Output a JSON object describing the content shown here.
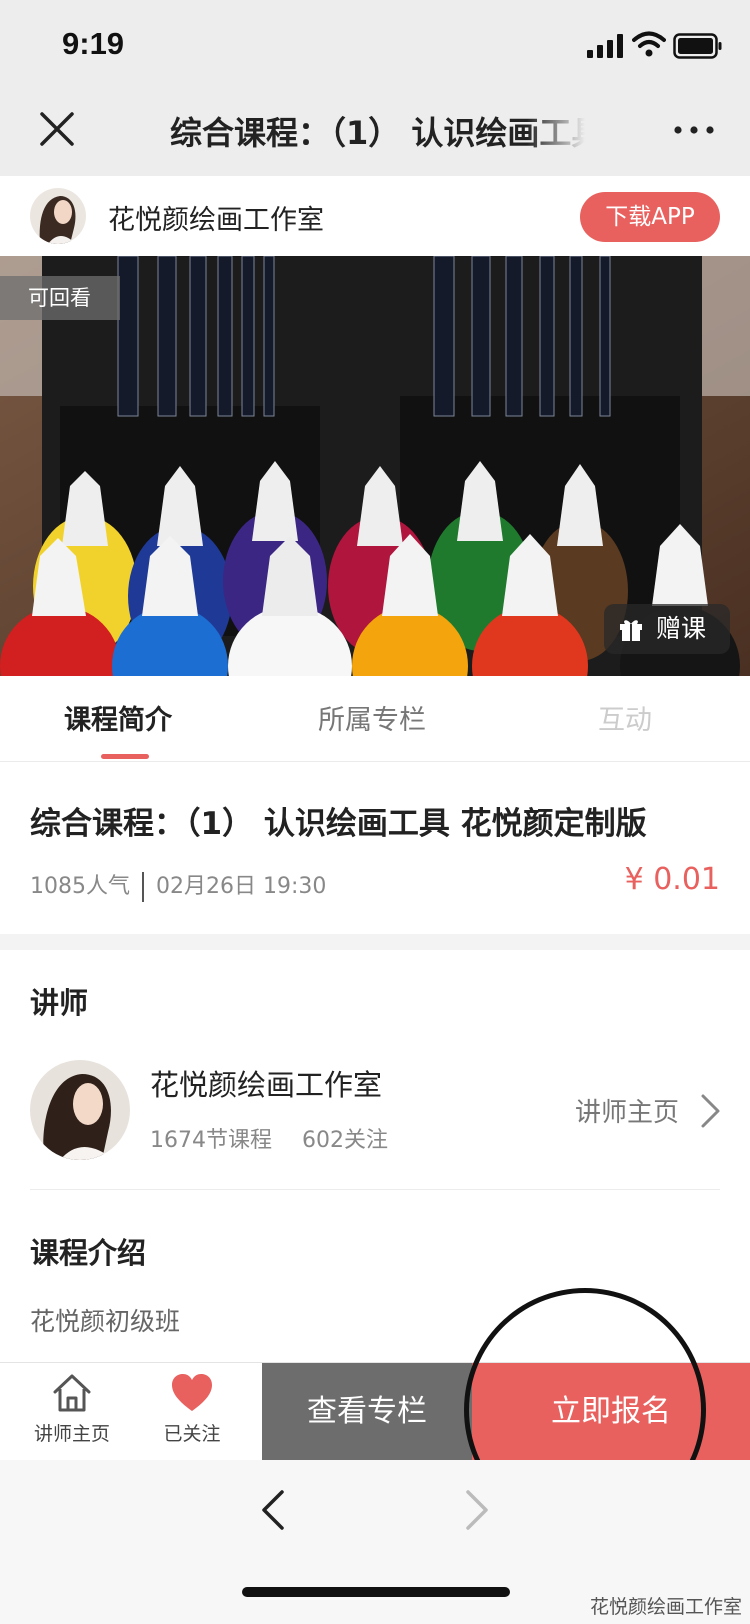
{
  "status_bar": {
    "time": "9:19",
    "icons": [
      "signal-icon",
      "wifi-icon",
      "battery-icon"
    ]
  },
  "nav": {
    "title": "综合课程：（1） 认识绘画工具 花悦颜定制版",
    "close_icon": "close-icon",
    "more_icon": "more-icon"
  },
  "shop": {
    "name": "花悦颜绘画工作室",
    "download_label": "下载APP"
  },
  "banner": {
    "replay_badge": "可回看",
    "gift_label": "赠课"
  },
  "tabs": [
    {
      "label": "课程简介",
      "active": true
    },
    {
      "label": "所属专栏",
      "active": false
    },
    {
      "label": "互动",
      "active": false
    }
  ],
  "course": {
    "title": "综合课程：（1） 认识绘画工具 花悦颜定制版",
    "popularity": "1085人气",
    "datetime": "02月26日 19:30",
    "price": "¥ 0.01"
  },
  "teacher_section": {
    "heading": "讲师",
    "name": "花悦颜绘画工作室",
    "lessons": "1674节课程",
    "followers": "602关注",
    "home_link": "讲师主页"
  },
  "intro": {
    "heading": "课程介绍",
    "body": "花悦颜初级班"
  },
  "action_bar": {
    "home_label": "讲师主页",
    "fav_label": "已关注",
    "column_button": "查看专栏",
    "enroll_button": "立即报名"
  },
  "watermark": "花悦颜绘画工作室",
  "colors": {
    "accent": "#e8615e",
    "dark_button": "#6d6d6d",
    "navbar_bg": "#ededed"
  }
}
